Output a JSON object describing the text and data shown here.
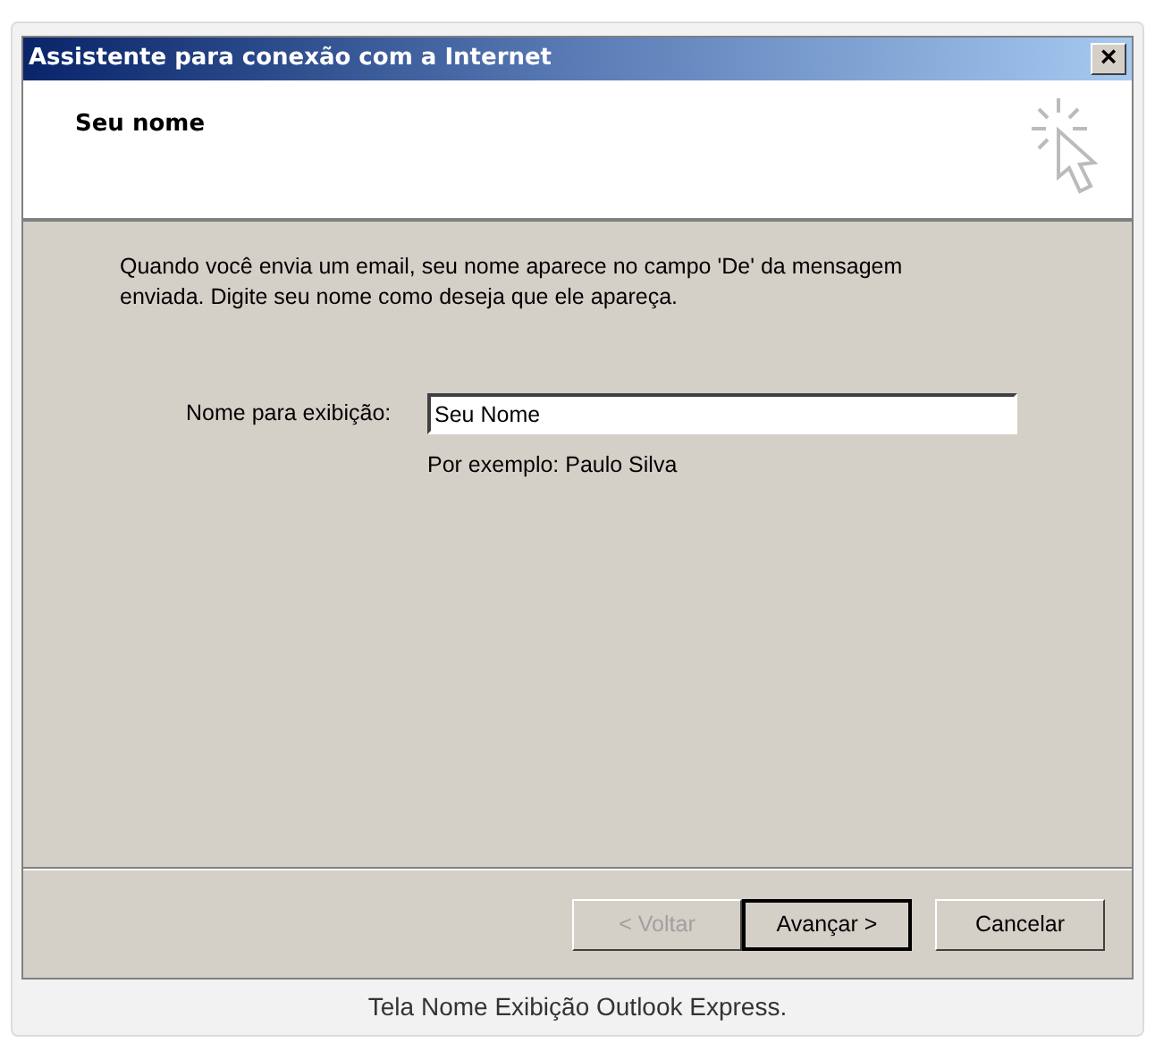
{
  "window": {
    "title": "Assistente para conexão com a Internet",
    "close": "×"
  },
  "header": {
    "title": "Seu nome"
  },
  "description": "Quando você envia um email, seu nome aparece no campo 'De' da mensagem enviada. Digite seu nome como deseja que ele apareça.",
  "field": {
    "label": "Nome para exibição:",
    "value": "Seu Nome",
    "hint": "Por exemplo: Paulo Silva"
  },
  "buttons": [
    {
      "label": "< Voltar",
      "disabled": true,
      "default": false
    },
    {
      "label": "Avançar >",
      "disabled": false,
      "default": true
    },
    {
      "label": "Cancelar",
      "disabled": false,
      "default": false
    }
  ],
  "caption": "Tela Nome Exibição Outlook Express."
}
